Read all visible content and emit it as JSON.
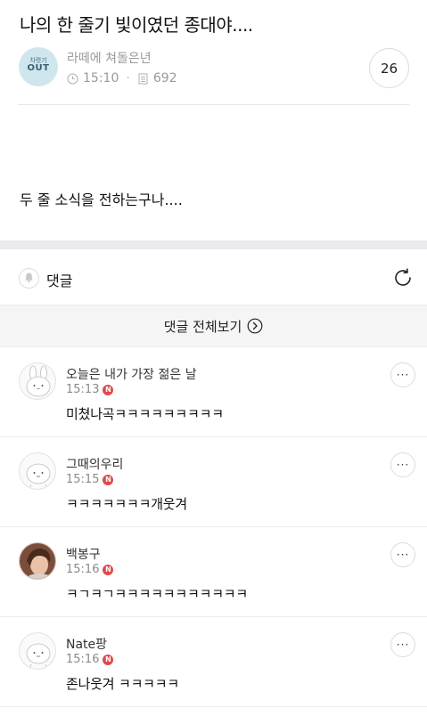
{
  "post": {
    "title": "나의 한 줄기 빛이였던 종대야....",
    "board_name": "라떼에 쳐돌은년",
    "board_logo_top": "차렷기",
    "board_logo_main": "OUT",
    "time": "15:10",
    "view_count": "692",
    "comment_count": "26",
    "body": "두 줄 소식을 전하는구나...."
  },
  "comments_section": {
    "label": "댓글",
    "view_all_label": "댓글 전체보기",
    "new_badge": "N",
    "more_label": "···"
  },
  "comments": [
    {
      "author": "오늘은 내가 가장 젊은 날",
      "time": "15:13",
      "text": "미쳤나곡ㅋㅋㅋㅋㅋㅋㅋㅋㅋ",
      "avatar": "bunny-icon"
    },
    {
      "author": "그때의우리",
      "time": "15:15",
      "text": "ㅋㅋㅋㅋㅋㅋㅋ개웃겨",
      "avatar": "default-face-icon"
    },
    {
      "author": "백봉구",
      "time": "15:16",
      "text": "ㅋㄱㅋㄱㅋㅋㅋㅋㅋㅋㅋㅋㅋㅋㅋ",
      "avatar": "photo-avatar"
    },
    {
      "author": "Nate팡",
      "time": "15:16",
      "text": "존나웃겨 ㅋㅋㅋㅋㅋ",
      "avatar": "default-face-icon"
    }
  ],
  "colors": {
    "new_badge": "#e04a4a",
    "separator": "#e9e9ee",
    "muted_text": "#9a9a9a",
    "board_avatar_bg": "#cfe6ef"
  }
}
